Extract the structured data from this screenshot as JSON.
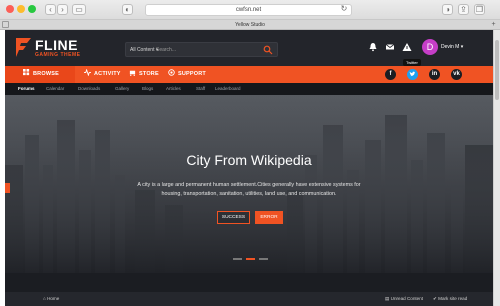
{
  "browser": {
    "url": "cwfsn.net",
    "tab_title": "Yellow Studio"
  },
  "site": {
    "logo": {
      "name": "FLINE",
      "tagline": "GAMING THEME"
    },
    "search": {
      "scope": "All Content ▾",
      "placeholder": "Search..."
    },
    "user": {
      "avatar_letter": "D",
      "name": "Devin M ▾"
    },
    "main_nav": [
      {
        "label": "BROWSE",
        "icon": "home-icon"
      },
      {
        "label": "ACTIVITY",
        "icon": "activity-icon"
      },
      {
        "label": "STORE",
        "icon": "cart-icon"
      },
      {
        "label": "SUPPORT",
        "icon": "support-icon"
      }
    ],
    "social": {
      "facebook": "f",
      "twitter_tooltip": "Twitter",
      "linkedin": "in",
      "vk": "vk"
    },
    "sub_nav": [
      "Forums",
      "Calendar",
      "Downloads",
      "Gallery",
      "Blogs",
      "Articles",
      "Staff",
      "Leaderboard"
    ],
    "hero": {
      "title": "City From Wikipedia",
      "text": "A city is a large and permanent human settlement.Cities generally have extensive systems for housing, transportation, sanitation, utilities, land use, and communication.",
      "buttons": {
        "success": "SUCCESS",
        "error": "ERROR"
      }
    },
    "footer": {
      "home": "Home",
      "unread": "Unread Content",
      "mark_read": "Mark site read"
    },
    "colors": {
      "accent": "#f05323",
      "header_bg": "#23252b",
      "avatar": "#c53ec7"
    }
  }
}
